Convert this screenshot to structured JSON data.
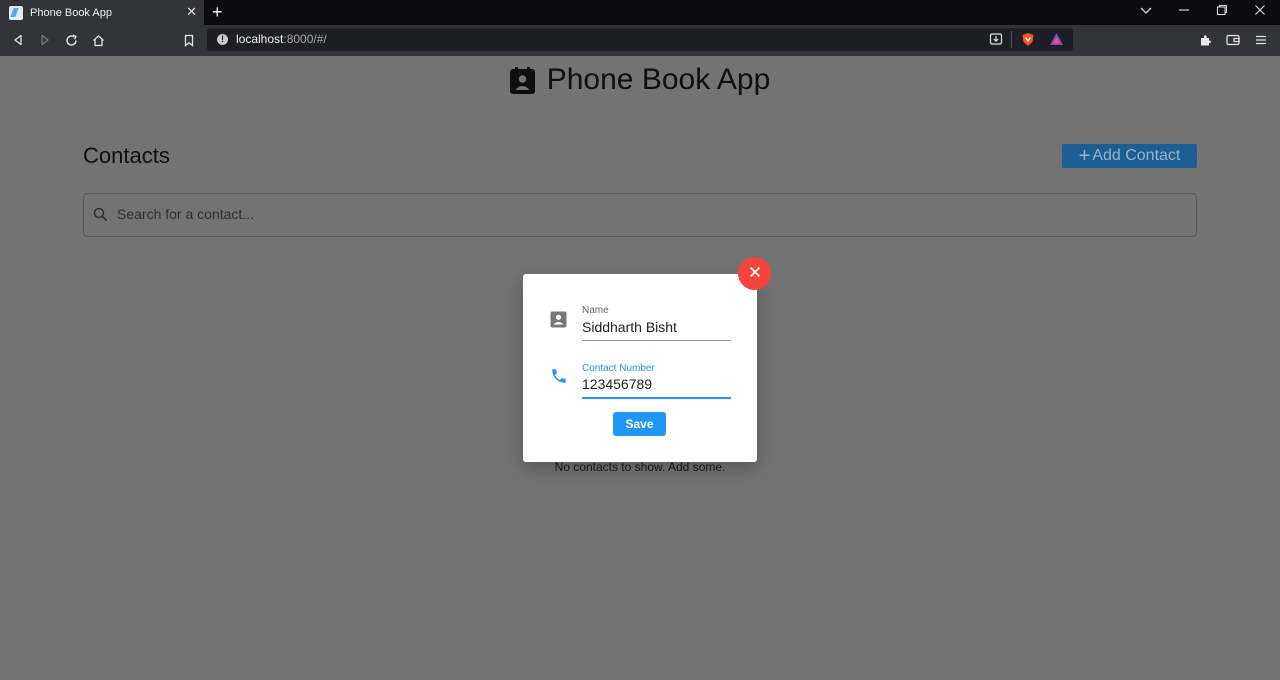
{
  "browser": {
    "tab_title": "Phone Book App",
    "tab_close": "✕",
    "new_tab": "+",
    "url_host": "localhost",
    "url_rest": ":8000/#/"
  },
  "app": {
    "title": "Phone Book App",
    "contacts_heading": "Contacts",
    "add_contact_plus": "+",
    "add_contact_label": "Add Contact",
    "search_placeholder": "Search for a contact...",
    "empty_message": "No contacts to show. Add some."
  },
  "dialog": {
    "name_label": "Name",
    "name_value": "Siddharth Bisht",
    "number_label": "Contact Number",
    "number_value": "123456789",
    "save_label": "Save"
  },
  "colors": {
    "accent": "#2196f3",
    "close": "#f34539",
    "overlay": "#737373"
  }
}
